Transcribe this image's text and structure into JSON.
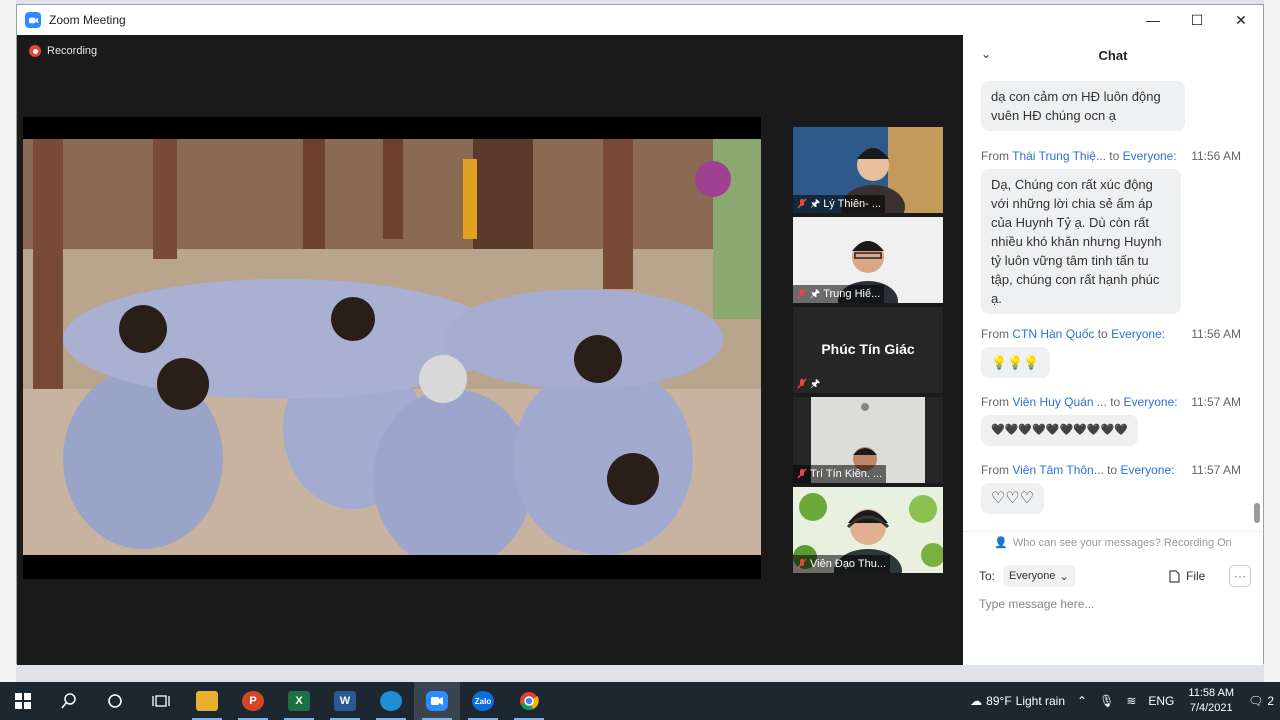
{
  "window": {
    "title": "Zoom Meeting",
    "minimize": "—",
    "maximize": "☐",
    "close": "✕"
  },
  "recording": {
    "label": "Recording"
  },
  "participants": [
    {
      "name": "Lý Thiên- ..."
    },
    {
      "name": "Trung Hiế..."
    },
    {
      "name": "Phúc Tín Giác"
    },
    {
      "name": "Trí Tín Kiên. ..."
    },
    {
      "name": "Viên Đạo Thu..."
    }
  ],
  "chat": {
    "title": "Chat",
    "messages": [
      {
        "text": "dạ con cảm ơn HĐ luôn động vuên HĐ chúng ocn ạ"
      },
      {
        "from_label": "From",
        "sender": "Thái Trung Thiệ...",
        "to_label": "to",
        "recipient": "Everyone:",
        "time": "11:56 AM",
        "text": "Dạ, Chúng con rất xúc động với những lời chia sẻ ấm áp của Huynh Tỷ ạ. Dù còn rất nhiều khó khăn nhưng Huynh tỷ luôn vững tâm tinh tấn tu tập, chúng con rất hạnh phúc ạ."
      },
      {
        "from_label": "From",
        "sender": "CTN Hàn Quốc",
        "to_label": "to",
        "recipient": "Everyone:",
        "time": "11:56 AM",
        "text": "💡💡💡"
      },
      {
        "from_label": "From",
        "sender": "Viên Huy Quán ...",
        "to_label": "to",
        "recipient": "Everyone:",
        "time": "11:57 AM",
        "text": "🖤🖤🖤🖤🖤🖤🖤🖤🖤🖤"
      },
      {
        "from_label": "From",
        "sender": "Viên Tâm Thôn...",
        "to_label": "to",
        "recipient": "Everyone:",
        "time": "11:57 AM",
        "text": "♡♡♡"
      }
    ],
    "privacy_note": "Who can see your messages? Recording On",
    "to_label": "To:",
    "to_value": "Everyone",
    "file_label": "File",
    "more_label": "···",
    "input_placeholder": "Type message here..."
  },
  "taskbar": {
    "weather_temp": "89°F",
    "weather_desc": "Light rain",
    "language": "ENG",
    "time": "11:58 AM",
    "date": "7/4/2021",
    "notifications": "2",
    "apps": [
      "P",
      "X",
      "W",
      "Zalo"
    ]
  }
}
